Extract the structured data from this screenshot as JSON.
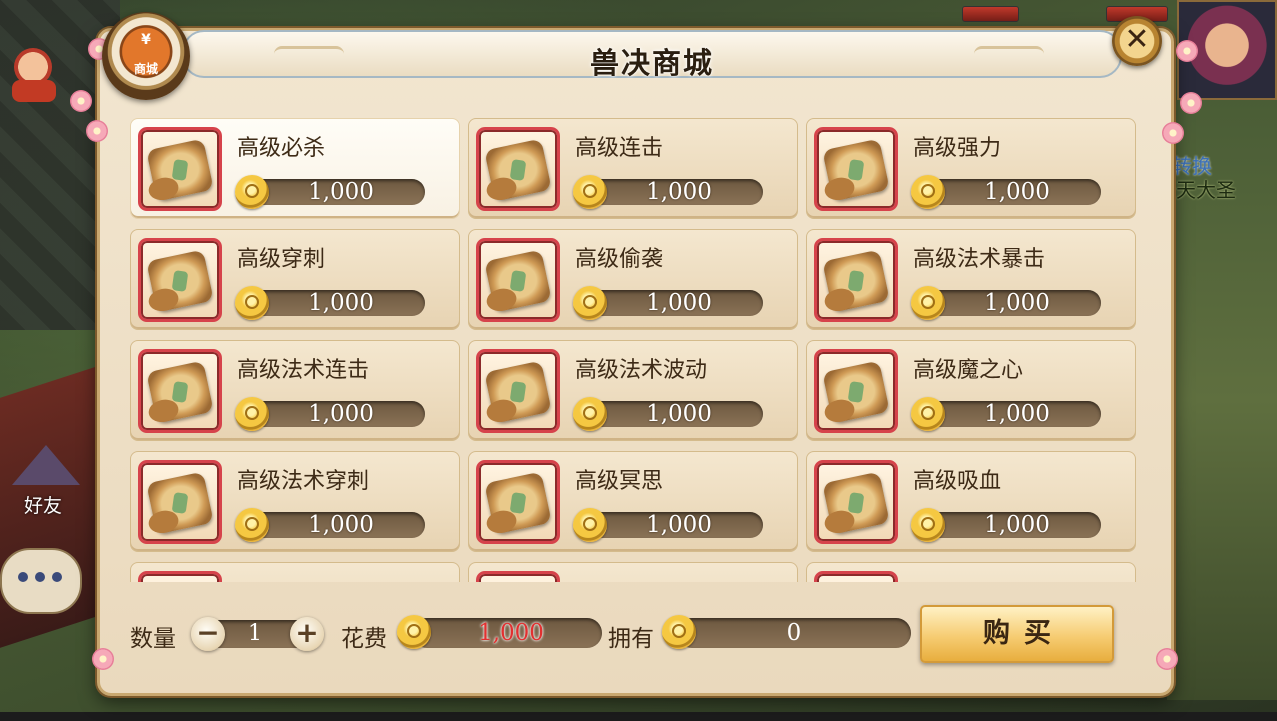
{
  "shop": {
    "title": "兽决商城",
    "emblem_symbol": "¥",
    "emblem_label": "商城",
    "close_symbol": "✕",
    "currency_icon": "gold-coin-icon",
    "item_icon": "skill-scroll-icon",
    "selected_index": 0,
    "items": [
      {
        "name": "高级必杀",
        "price": "1,000"
      },
      {
        "name": "高级连击",
        "price": "1,000"
      },
      {
        "name": "高级强力",
        "price": "1,000"
      },
      {
        "name": "高级穿刺",
        "price": "1,000"
      },
      {
        "name": "高级偷袭",
        "price": "1,000"
      },
      {
        "name": "高级法术暴击",
        "price": "1,000"
      },
      {
        "name": "高级法术连击",
        "price": "1,000"
      },
      {
        "name": "高级法术波动",
        "price": "1,000"
      },
      {
        "name": "高级魔之心",
        "price": "1,000"
      },
      {
        "name": "高级法术穿刺",
        "price": "1,000"
      },
      {
        "name": "高级冥思",
        "price": "1,000"
      },
      {
        "name": "高级吸血",
        "price": "1,000"
      }
    ]
  },
  "footer": {
    "quantity_label": "数量",
    "quantity": "1",
    "minus_symbol": "−",
    "plus_symbol": "+",
    "cost_label": "花费",
    "cost": "1,000",
    "owned_label": "拥有",
    "owned": "0",
    "buy_label": "购买"
  },
  "game_background": {
    "friend_label": "好友",
    "side_text_1": "转换",
    "side_text_2": "天大圣"
  },
  "colors": {
    "accent_red": "#e23030",
    "frame_gold": "#c9a870",
    "panel_cream": "#f2e6d0"
  }
}
